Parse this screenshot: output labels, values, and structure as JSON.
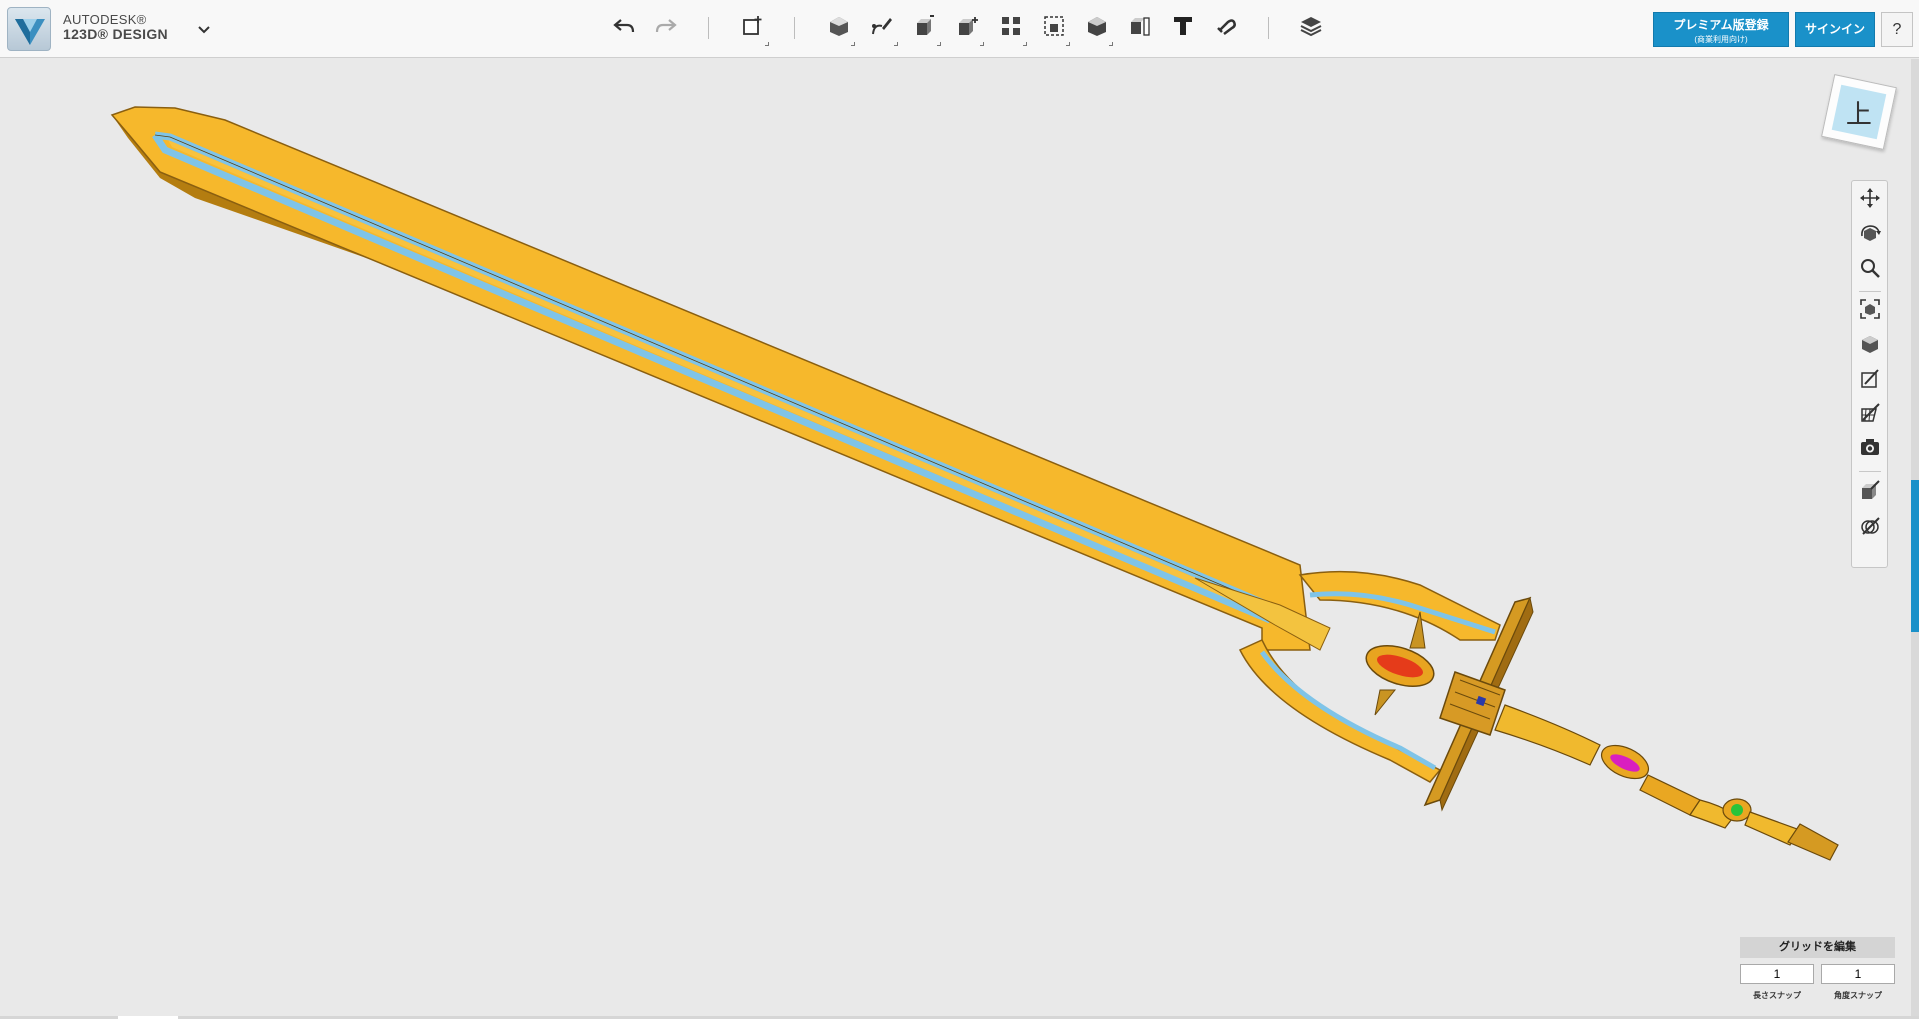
{
  "app": {
    "brand_line1": "AUTODESK®",
    "brand_line2": "123D® DESIGN"
  },
  "toolbar": {
    "undo": "undo-icon",
    "redo": "redo-icon",
    "tools": [
      "primitives",
      "sketch",
      "construct",
      "modify",
      "pattern",
      "grouping",
      "combine",
      "measure",
      "text",
      "snap",
      "material"
    ]
  },
  "header_buttons": {
    "premium_line1": "プレミアム版登録",
    "premium_line2": "(商業利用向け)",
    "signin": "サインイン",
    "help": "?"
  },
  "viewcube": {
    "face_label": "上"
  },
  "grid_panel": {
    "title": "グリッドを編集",
    "length_snap_value": "1",
    "angle_snap_value": "1",
    "length_snap_label": "長さスナップ",
    "angle_snap_label": "角度スナップ"
  },
  "colors": {
    "accent": "#1a91c9",
    "blade": "#f5b52a",
    "fuller": "#7fc4e8"
  }
}
